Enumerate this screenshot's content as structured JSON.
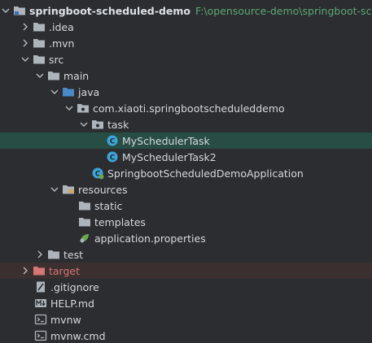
{
  "project": {
    "root_label": "springboot-scheduled-demo",
    "root_path": "F:\\opensource-demo\\springboot-schedu"
  },
  "tree": {
    "idea": ".idea",
    "mvn": ".mvn",
    "src": "src",
    "main": "main",
    "java": "java",
    "package": "com.xiaoti.springbootscheduleddemo",
    "task": "task",
    "class1": "MySchedulerTask",
    "class2": "MySchedulerTask2",
    "app": "SpringbootScheduledDemoApplication",
    "resources": "resources",
    "static": "static",
    "templates": "templates",
    "props": "application.properties",
    "test": "test",
    "target": "target",
    "gitignore": ".gitignore",
    "help": "HELP.md",
    "mvnw": "mvnw",
    "mvnwcmd": "mvnw.cmd"
  },
  "colors": {
    "background": "#2b2d30",
    "selection": "#284d45",
    "folder": "#aeb4bb",
    "class_icon": "#3fa4d6",
    "excluded_folder": "#d67676",
    "path_text": "#5fa873"
  }
}
